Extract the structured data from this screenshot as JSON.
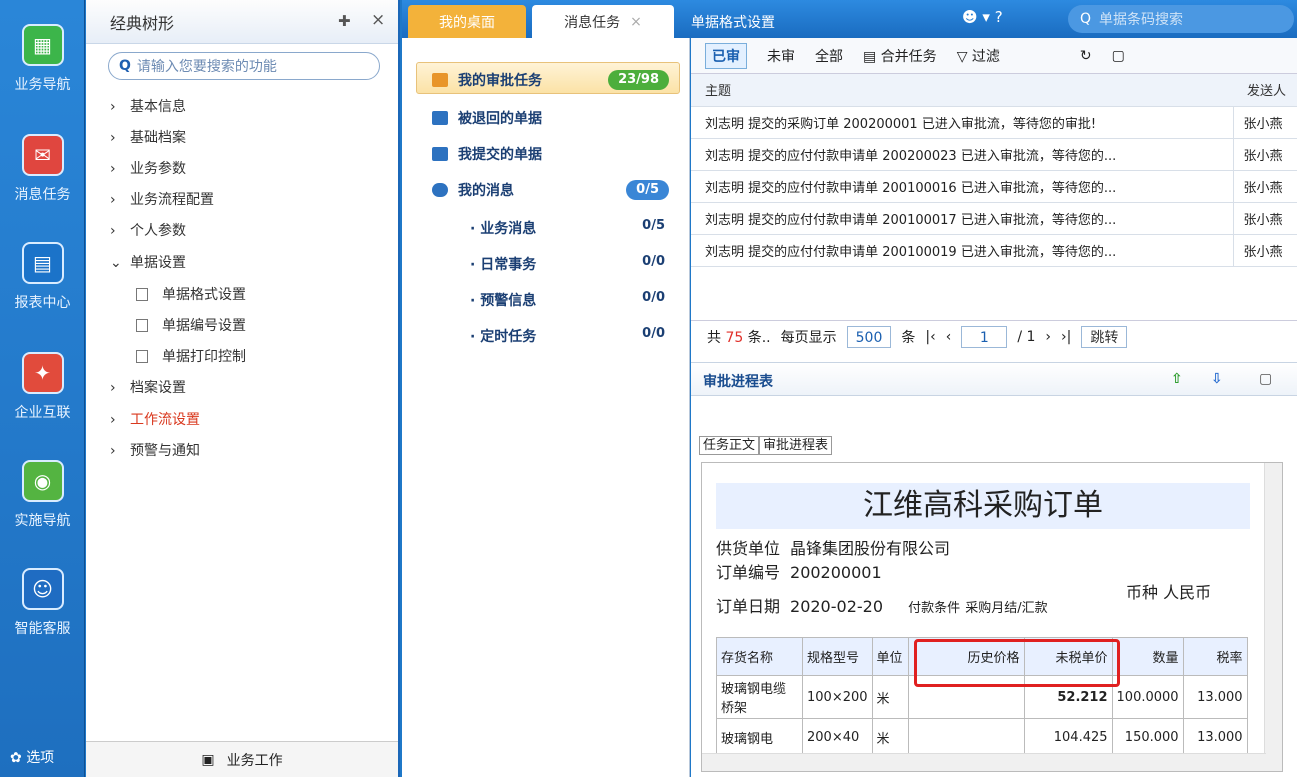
{
  "rail": {
    "items": [
      {
        "label": "业务导航",
        "icon": "business-nav-icon"
      },
      {
        "label": "消息任务",
        "icon": "message-task-icon"
      },
      {
        "label": "报表中心",
        "icon": "report-center-icon"
      },
      {
        "label": "企业互联",
        "icon": "enterprise-link-icon"
      },
      {
        "label": "实施导航",
        "icon": "compass-icon"
      },
      {
        "label": "智能客服",
        "icon": "customer-service-icon"
      }
    ],
    "options_label": "选项"
  },
  "tree": {
    "title": "经典树形",
    "search_placeholder": "请输入您要搜索的功能",
    "nodes": [
      {
        "label": "基本信息"
      },
      {
        "label": "基础档案"
      },
      {
        "label": "业务参数"
      },
      {
        "label": "业务流程配置"
      },
      {
        "label": "个人参数"
      },
      {
        "label": "单据设置"
      },
      {
        "label": "单据格式设置"
      },
      {
        "label": "单据编号设置"
      },
      {
        "label": "单据打印控制"
      },
      {
        "label": "档案设置"
      },
      {
        "label": "工作流设置"
      },
      {
        "label": "预警与通知"
      }
    ],
    "footer": "业务工作"
  },
  "topbar": {
    "tabs": [
      "我的桌面",
      "消息任务",
      "单据格式设置"
    ],
    "close": "×",
    "search_placeholder": "单据条码搜索"
  },
  "tasks": {
    "items": [
      {
        "label": "我的审批任务",
        "badge": "23/98"
      },
      {
        "label": "被退回的单据"
      },
      {
        "label": "我提交的单据"
      },
      {
        "label": "我的消息",
        "badge": "0/5"
      }
    ],
    "subs": [
      {
        "label": "业务消息",
        "value": "0/5"
      },
      {
        "label": "日常事务",
        "value": "0/0"
      },
      {
        "label": "预警信息",
        "value": "0/0"
      },
      {
        "label": "定时任务",
        "value": "0/0"
      }
    ]
  },
  "list": {
    "toolbar": [
      "已审",
      "未审",
      "全部",
      "合并任务",
      "过滤"
    ],
    "headers": [
      "主题",
      "发送人"
    ],
    "rows": [
      {
        "subject": "刘志明 提交的采购订单 200200001 已进入审批流，等待您的审批!",
        "sender": "张小燕"
      },
      {
        "subject": "刘志明 提交的应付付款申请单 200200023 已进入审批流，等待您的...",
        "sender": "张小燕"
      },
      {
        "subject": "刘志明 提交的应付付款申请单 200100016 已进入审批流，等待您的...",
        "sender": "张小燕"
      },
      {
        "subject": "刘志明 提交的应付付款申请单 200100017 已进入审批流，等待您的...",
        "sender": "张小燕"
      },
      {
        "subject": "刘志明 提交的应付付款申请单 200100019 已进入审批流，等待您的...",
        "sender": "张小燕"
      }
    ],
    "pager": {
      "total_prefix": "共",
      "total": "75",
      "total_suffix": "条..",
      "per_page_label": "每页显示",
      "per_page": "500",
      "unit": "条",
      "page": "1",
      "page_total": "/ 1",
      "go": "跳转"
    }
  },
  "approval": {
    "title": "审批进程表",
    "subtabs": [
      "任务正文",
      "审批进程表"
    ]
  },
  "doc": {
    "title": "江维高科采购订单",
    "supplier_label": "供货单位",
    "supplier": "晶锋集团股份有限公司",
    "order_no_label": "订单编号",
    "order_no": "200200001",
    "date_label": "订单日期",
    "date": "2020-02-20",
    "terms_label": "付款条件",
    "terms": "采购月结/汇款",
    "currency_label": "币种",
    "currency": "人民币",
    "columns": [
      "存货名称",
      "规格型号",
      "单位",
      "历史价格",
      "未税单价",
      "数量",
      "税率"
    ],
    "rows": [
      {
        "name": "玻璃钢电缆桥架",
        "spec": "100×200",
        "unit": "米",
        "hist": "",
        "price": "52.212",
        "qty": "100.0000",
        "tax": "13.000"
      },
      {
        "name": "玻璃钢电",
        "spec": "200×40",
        "unit": "米",
        "hist": "",
        "price": "104.425",
        "qty": "150.000",
        "tax": "13.000"
      }
    ]
  }
}
